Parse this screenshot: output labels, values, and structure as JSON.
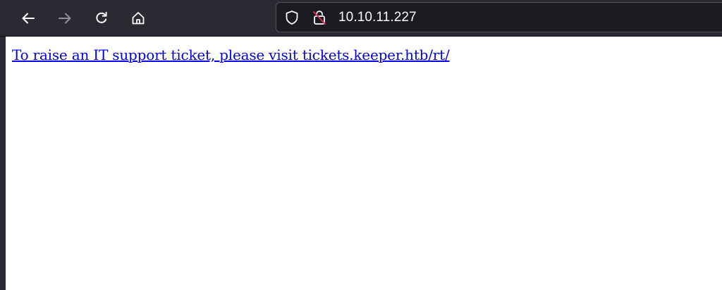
{
  "browser": {
    "address_bar": {
      "url": "10.10.11.227"
    },
    "icons": {
      "back": "arrow-left-icon",
      "forward": "arrow-right-icon",
      "reload": "reload-icon",
      "home": "home-icon",
      "tracking_protection": "shield-icon",
      "insecure_connection": "lock-strikethrough-icon"
    },
    "colors": {
      "toolbar": "#2b2a33",
      "urlbar_background": "#1c1b22",
      "insecure_strike": "#e22850",
      "link": "#0000ee"
    }
  },
  "page": {
    "link_text": "To raise an IT support ticket, please visit tickets.keeper.htb/rt/"
  }
}
